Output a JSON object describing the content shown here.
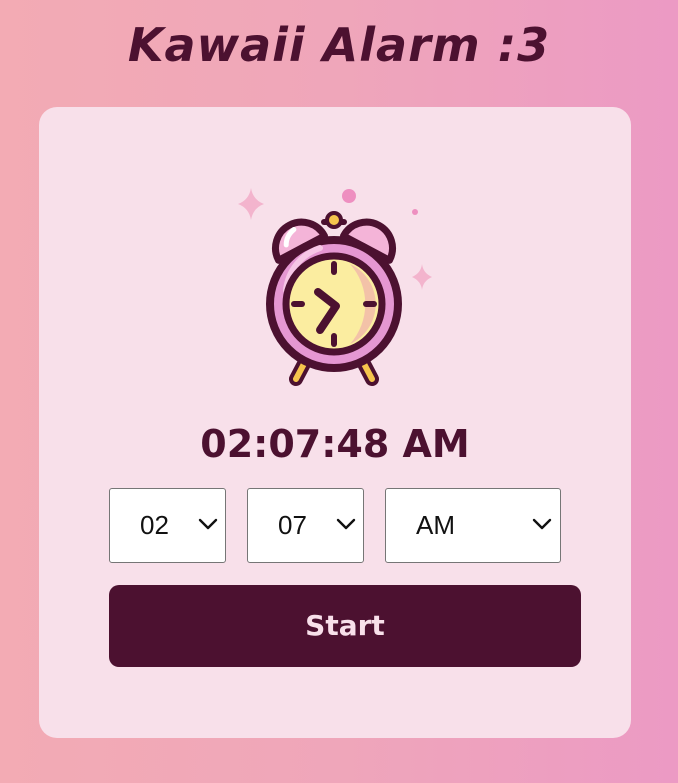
{
  "app": {
    "title": "Kawaii Alarm :3"
  },
  "clock": {
    "current_time": "02:07:48 AM",
    "icon": "alarm-clock-icon"
  },
  "alarm_form": {
    "hour": {
      "selected": "02"
    },
    "minute": {
      "selected": "07"
    },
    "period": {
      "selected": "AM"
    },
    "start_label": "Start"
  },
  "colors": {
    "background_left": "#f3abb4",
    "background_right": "#ec9ac4",
    "card": "#f8e0ea",
    "accent": "#4c1130",
    "clock_body": "#e597d2",
    "clock_face": "#fbeda0"
  }
}
